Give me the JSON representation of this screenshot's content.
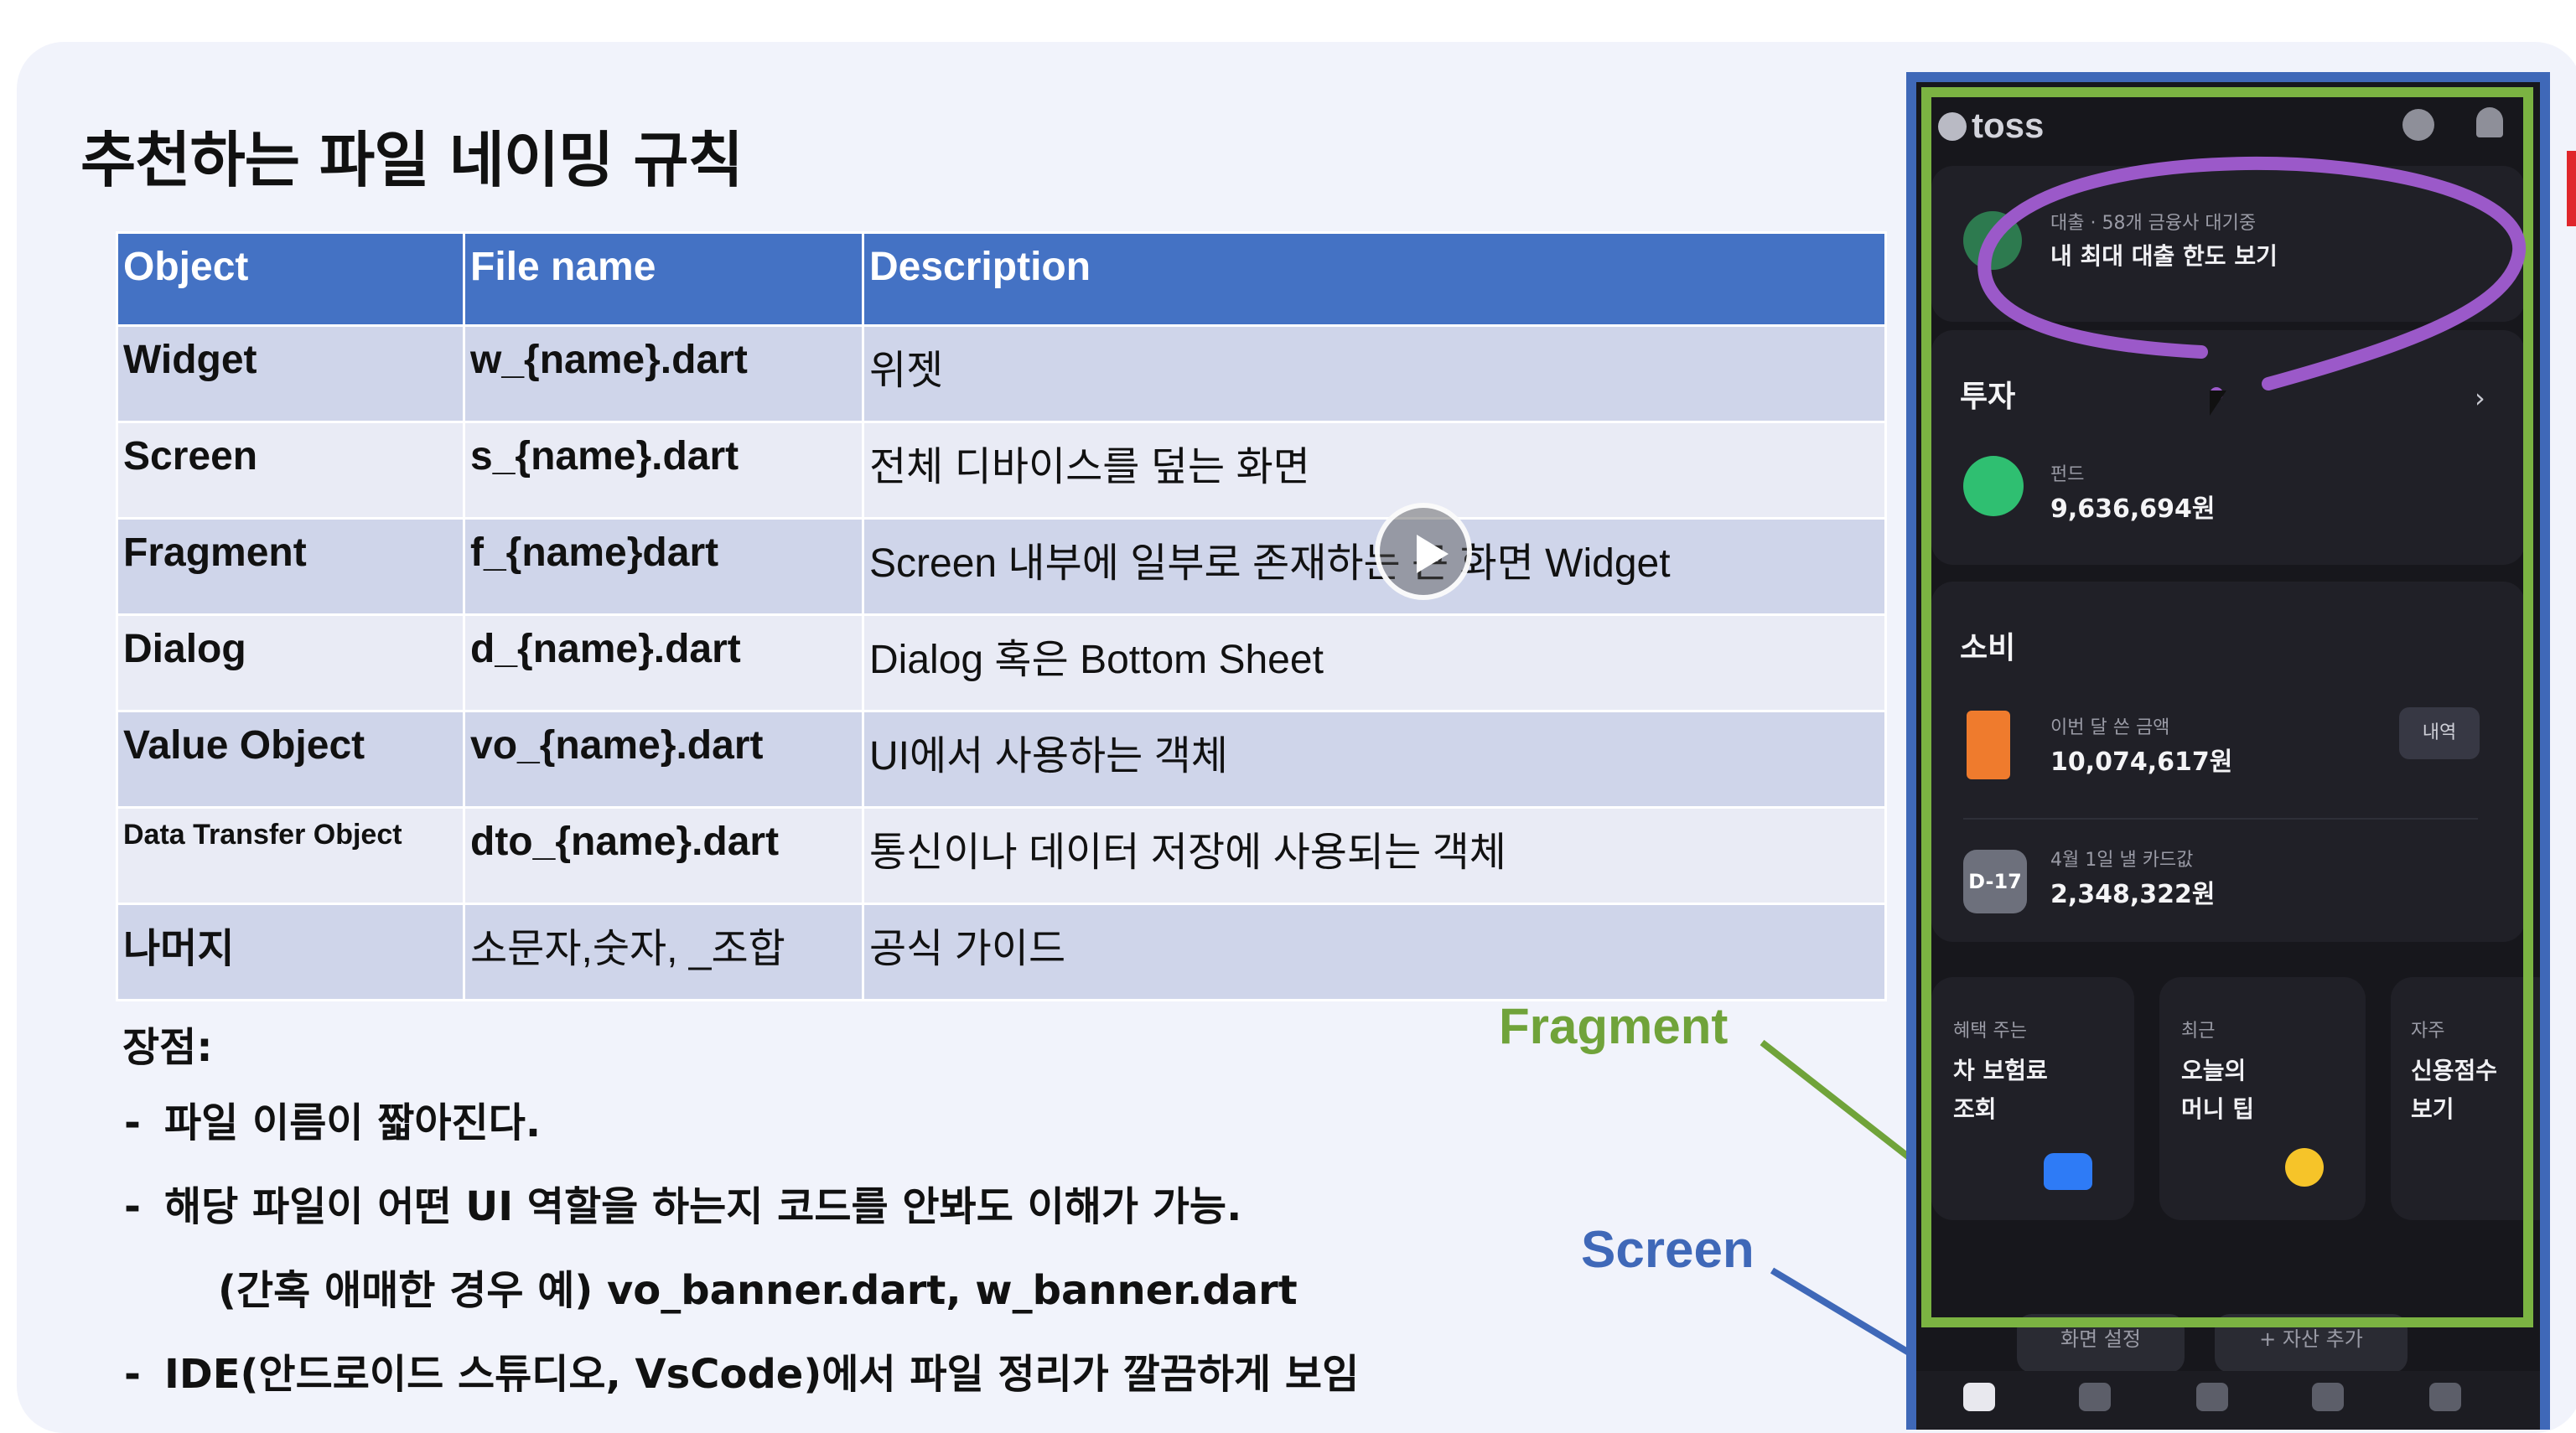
{
  "slide": {
    "title": "추천하는 파일 네이밍 규칙",
    "table": {
      "headers": [
        "Object",
        "File name",
        "Description"
      ],
      "rows": [
        [
          "Widget",
          "w_{name}.dart",
          "위젯"
        ],
        [
          "Screen",
          "s_{name}.dart",
          "전체 디바이스를 덮는 화면"
        ],
        [
          "Fragment",
          "f_{name}dart",
          "Screen 내부에 일부로 존재하는 큰 화면 Widget"
        ],
        [
          "Dialog",
          "d_{name}.dart",
          "Dialog 혹은 Bottom Sheet"
        ],
        [
          "Value Object",
          "vo_{name}.dart",
          "UI에서 사용하는 객체"
        ],
        [
          "Data Transfer Object",
          "dto_{name}.dart",
          "통신이나 데이터 저장에 사용되는 객체"
        ],
        [
          "나머지",
          "소문자,숫자, _조합",
          "공식 가이드"
        ]
      ]
    },
    "pros_title": "장점:",
    "pros": [
      {
        "dash": "-",
        "text": "파일 이름이 짧아진다."
      },
      {
        "dash": "-",
        "text": "해당 파일이 어떤 UI 역할을 하는지 코드를 안봐도 이해가 가능."
      },
      {
        "dash": "",
        "text": "(간혹 애매한 경우 예) vo_banner.dart, w_banner.dart"
      },
      {
        "dash": "-",
        "text": "IDE(안드로이드 스튜디오, VsCode)에서 파일 정리가 깔끔하게 보임"
      }
    ],
    "label_fragment": "Fragment",
    "label_screen": "Screen"
  },
  "phone": {
    "logo": "toss",
    "loan": {
      "caption": "대출 · 58개 금융사 대기중",
      "title": "내 최대 대출 한도 보기"
    },
    "invest": {
      "title": "투자",
      "fund_caption": "펀드",
      "fund_value": "9,636,694원"
    },
    "spend": {
      "title": "소비",
      "month_caption": "이번 달 쓴 금액",
      "month_value": "10,074,617원",
      "history_button": "내역",
      "dday": "D-17",
      "card_caption": "4월 1일 낼 카드값",
      "card_value": "2,348,322원"
    },
    "tiles": [
      {
        "caption": "혜택 주는",
        "line1": "차 보험료",
        "line2": "조회"
      },
      {
        "caption": "최근",
        "line1": "오늘의",
        "line2": "머니 팁"
      },
      {
        "caption": "자주",
        "line1": "신용점수",
        "line2": "보기"
      }
    ],
    "bottom_buttons": [
      "화면 설정",
      "+ 자산 추가"
    ]
  },
  "colors": {
    "header_blue": "#4472c4",
    "fragment_green": "#7bb342",
    "screen_blue": "#3f68b8",
    "annotation_purple": "#9b59c9"
  }
}
